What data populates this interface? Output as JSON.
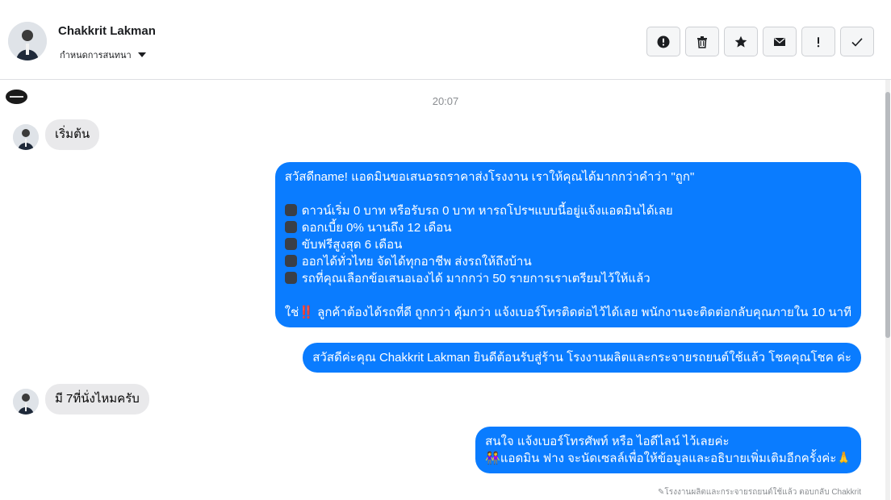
{
  "header": {
    "contact_name": "Chakkrit Lakman",
    "assign_label": "กำหนดการสนทนา",
    "actions": [
      {
        "icon": "alert-circle-icon",
        "name": "spam-button"
      },
      {
        "icon": "trash-icon",
        "name": "delete-button"
      },
      {
        "icon": "star-icon",
        "name": "star-button"
      },
      {
        "icon": "envelope-icon",
        "name": "mark-unread-button"
      },
      {
        "icon": "exclamation-icon",
        "name": "follow-up-button"
      },
      {
        "icon": "check-icon",
        "name": "mark-done-button"
      }
    ]
  },
  "thread": {
    "timestamp": "20:07",
    "messages": {
      "m1": "เริ่มต้น",
      "m2": {
        "lines": [
          "สวัสดีname! แอดมินขอเสนอรถราคาส่งโรงงาน เราให้คุณได้มากกว่าคำว่า \"ถูก\"",
          "",
          "ดาวน์เริ่ม 0 บาท หรือรับรถ 0 บาท หารถโปรฯแบบนี้อยู่แจ้งแอดมินได้เลย",
          "ดอกเบี้ย 0% นานถึง 12 เดือน",
          "ขับฟรีสูงสุด 6 เดือน",
          "ออกได้ทั่วไทย จัดได้ทุกอาชีพ ส่งรถให้ถึงบ้าน",
          "รถที่คุณเลือกข้อเสนอเองได้ มากกว่า 50 รายการเราเตรียมไว้ให้แล้ว",
          "",
          "ใช่",
          "ลูกค้าต้องได้รถที่ดี ถูกกว่า คุ้มกว่า แจ้งเบอร์โทรติดต่อไว้ได้เลย พนักงานจะติดต่อกลับคุณภายใน 10 นาที"
        ],
        "emphasis": "‼️"
      },
      "m3": "สวัสดีค่ะคุณ Chakkrit Lakman ยินดีต้อนรับสู่ร้าน โรงงานผลิตและกระจายรถยนต์ใช้แล้ว โชคคุณโชค ค่ะ",
      "m4": "มี 7ที่นั่งไหมครับ",
      "m5": {
        "line1": "สนใจ แจ้งเบอร์โทรศัพท์ หรือ ไอดีไลน์  ไว้เลยค่ะ",
        "line2_emoji": "👭",
        "line2": "แอดมิน ฟาง จะนัดเซลล์เพื่อให้ข้อมูลและอธิบายเพิ่มเติมอีกครั้งค่ะ",
        "line2_end_emoji": "🙏"
      }
    },
    "footnote": "โรงงานผลิตและกระจายรถยนต์ใช้แล้ว ตอบกลับ Chakkrit"
  }
}
